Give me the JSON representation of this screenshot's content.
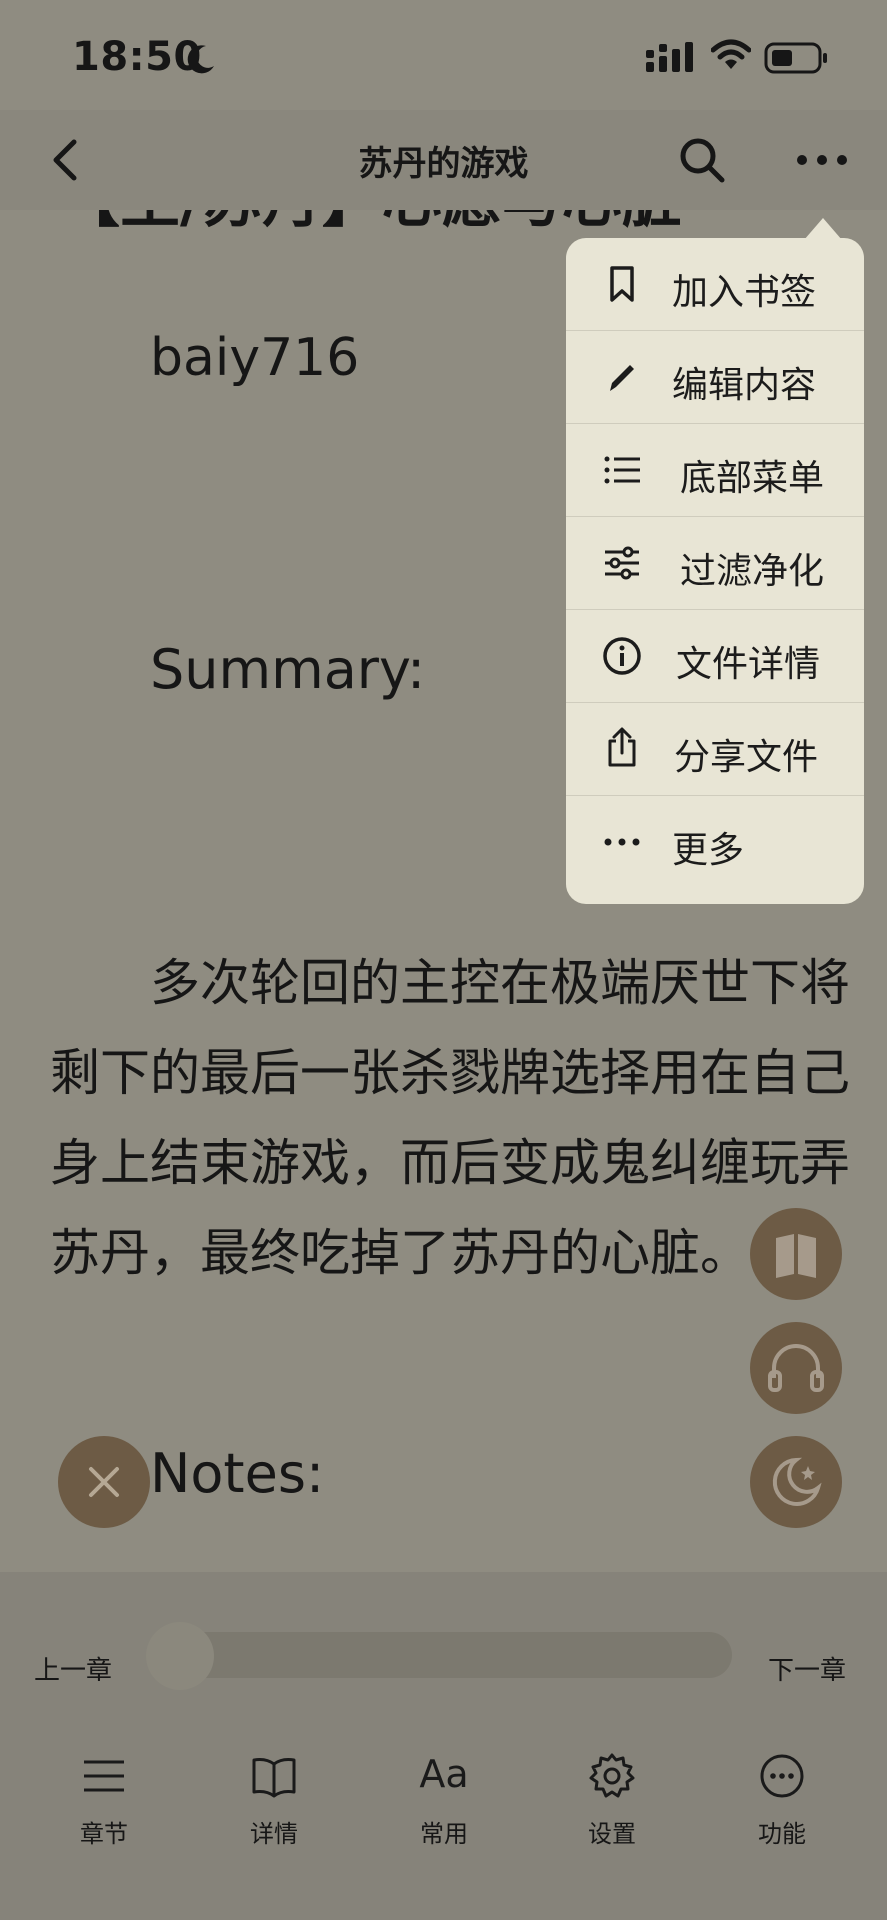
{
  "status_bar": {
    "time": "18:50"
  },
  "nav": {
    "title": "苏丹的游戏"
  },
  "content": {
    "author": "baiy716",
    "summary_label": "Summary:",
    "summary_text": "多次轮回的主控在极端厌世下将剩下的最后一张杀戮牌选择用在自己身上结束游戏，而后变成鬼纠缠玩弄苏丹，最终吃掉了苏丹的心脏。",
    "notes_label": "Notes:",
    "title_cut": "【主/苏丹】心愿与心脏"
  },
  "menu": {
    "items": [
      {
        "label": "加入书签",
        "icon": "bookmark-icon"
      },
      {
        "label": "编辑内容",
        "icon": "pencil-icon"
      },
      {
        "label": "底部菜单",
        "icon": "list-icon"
      },
      {
        "label": "过滤净化",
        "icon": "sliders-icon"
      },
      {
        "label": "文件详情",
        "icon": "info-icon"
      },
      {
        "label": "分享文件",
        "icon": "share-icon"
      },
      {
        "label": "更多",
        "icon": "ellipsis-icon"
      }
    ]
  },
  "bottom": {
    "prev_chapter": "上一章",
    "next_chapter": "下一章",
    "progress": 0,
    "tabs": [
      {
        "label": "章节",
        "icon": "menu-lines-icon"
      },
      {
        "label": "详情",
        "icon": "book-icon"
      },
      {
        "label": "常用",
        "icon": "font-icon"
      },
      {
        "label": "设置",
        "icon": "gear-icon"
      },
      {
        "label": "功能",
        "icon": "more-circle-icon"
      }
    ],
    "font_glyph": "Aa"
  },
  "colors": {
    "background": "#8f8c81",
    "menu_bg": "#e8e5d5",
    "fab_bg": "#6d5b45"
  }
}
